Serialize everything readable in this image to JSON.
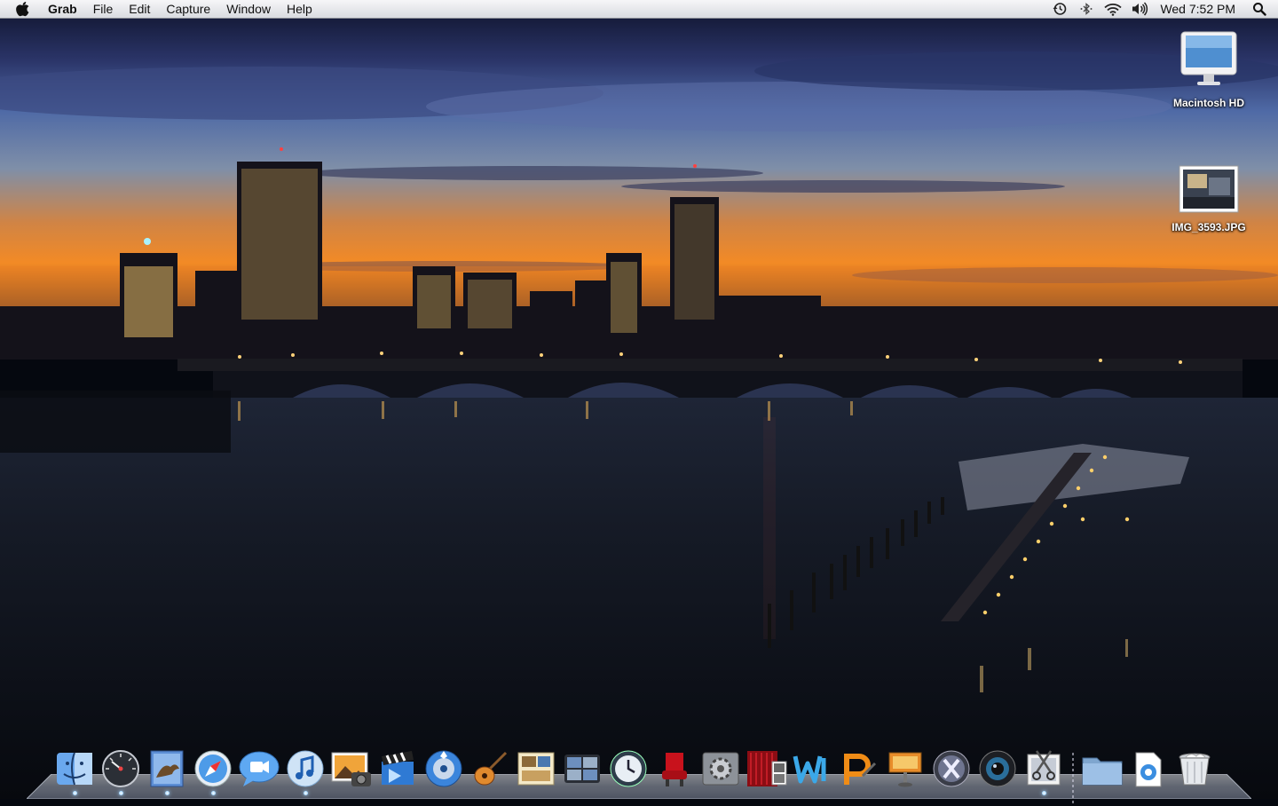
{
  "menubar": {
    "app_name": "Grab",
    "menus": [
      "File",
      "Edit",
      "Capture",
      "Window",
      "Help"
    ],
    "clock": "Wed 7:52 PM",
    "status_icons": [
      "time-machine-icon",
      "bluetooth-icon",
      "wifi-icon",
      "volume-icon"
    ]
  },
  "desktop": {
    "icons": [
      {
        "label": "Macintosh HD",
        "icon": "imac-hard-drive-icon"
      },
      {
        "label": "IMG_3593.JPG",
        "icon": "image-file-icon"
      }
    ]
  },
  "dock": {
    "apps": [
      {
        "name": "finder",
        "running": true
      },
      {
        "name": "dashboard",
        "running": true
      },
      {
        "name": "mail",
        "running": true
      },
      {
        "name": "safari",
        "running": true
      },
      {
        "name": "ichat",
        "running": false
      },
      {
        "name": "itunes",
        "running": true
      },
      {
        "name": "iphoto",
        "running": false
      },
      {
        "name": "imovie",
        "running": false
      },
      {
        "name": "idvd",
        "running": false
      },
      {
        "name": "garageband",
        "running": false
      },
      {
        "name": "iweb-preview",
        "running": false
      },
      {
        "name": "spaces",
        "running": false
      },
      {
        "name": "time-machine",
        "running": false
      },
      {
        "name": "front-row",
        "running": false
      },
      {
        "name": "system-preferences",
        "running": false
      },
      {
        "name": "photo-booth",
        "running": false
      },
      {
        "name": "iweb",
        "running": false
      },
      {
        "name": "pages",
        "running": false
      },
      {
        "name": "keynote",
        "running": false
      },
      {
        "name": "mac-os-x",
        "running": false
      },
      {
        "name": "aperture",
        "running": false
      },
      {
        "name": "grab",
        "running": true
      }
    ],
    "right": [
      "documents-folder",
      "downloads-stack",
      "trash"
    ]
  }
}
